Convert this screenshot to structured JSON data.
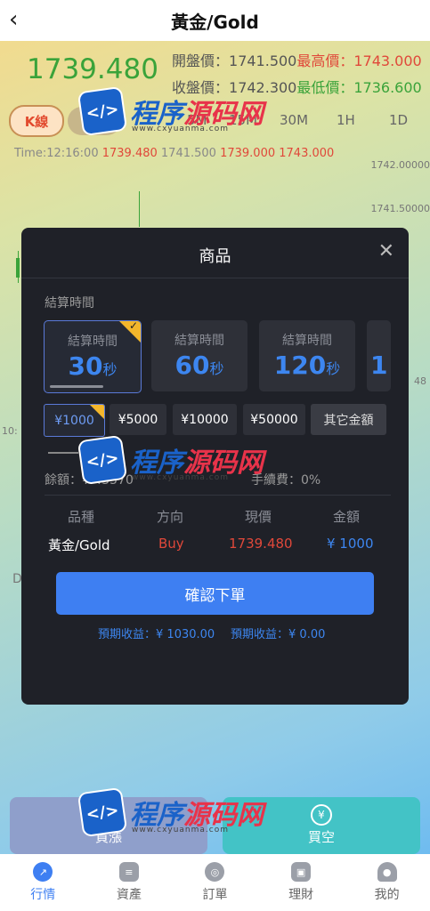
{
  "header": {
    "back_icon": "chevron-left-icon",
    "title": "黃金/Gold"
  },
  "quote": {
    "price": "1739.480",
    "open_label": "開盤價：",
    "open": "1741.500",
    "high_label": "最高價：",
    "high": "1743.000",
    "close_label": "收盤價：",
    "close": "1742.300",
    "low_label": "最低價：",
    "low": "1736.600"
  },
  "chart_tabs": {
    "kline": "K線",
    "other": "淡",
    "periods": [
      "5M",
      "15M",
      "30M",
      "1H",
      "1D"
    ]
  },
  "chart_info": {
    "time_label": "Time:",
    "time": "12:16:00",
    "v1": "1739.480",
    "v2": "1741.500",
    "v3": "1739.000",
    "v4": "1743.000",
    "y_ticks": [
      "1742.00000",
      "1741.50000",
      "48"
    ],
    "left_tick": "10:",
    "left_marker": "D"
  },
  "modal": {
    "title": "商品",
    "close_icon": "close-icon",
    "settle_label": "結算時間",
    "time_options": [
      {
        "label": "結算時間",
        "value": "30",
        "unit": "秒",
        "selected": true
      },
      {
        "label": "結算時間",
        "value": "60",
        "unit": "秒",
        "selected": false
      },
      {
        "label": "結算時間",
        "value": "120",
        "unit": "秒",
        "selected": false
      },
      {
        "label": "",
        "value": "1",
        "unit": "",
        "selected": false
      }
    ],
    "amount_options": [
      "¥1000",
      "¥5000",
      "¥10000",
      "¥50000"
    ],
    "other_amount": "其它金額",
    "balance_label": "餘額：",
    "balance_value": "¥ 45570",
    "fee_label": "手續費：",
    "fee_value": "0%",
    "columns": [
      "品種",
      "方向",
      "現價",
      "金額"
    ],
    "row": {
      "symbol": "黃金/Gold",
      "direction": "Buy",
      "price": "1739.480",
      "amount": "¥ 1000"
    },
    "confirm_label": "確認下單",
    "expect1_label": "預期收益：",
    "expect1_value": "¥ 1030.00",
    "expect2_label": "預期收益：",
    "expect2_value": "¥  0.00"
  },
  "actions": {
    "up_label": "買漲",
    "down_label": "買空",
    "up_icon": "yen-icon",
    "down_icon": "yen-icon"
  },
  "navbar": [
    {
      "label": "行情",
      "icon": "compass-icon",
      "active": true
    },
    {
      "label": "資產",
      "icon": "wallet-icon",
      "active": false
    },
    {
      "label": "訂單",
      "icon": "order-icon",
      "active": false
    },
    {
      "label": "理財",
      "icon": "finance-icon",
      "active": false
    },
    {
      "label": "我的",
      "icon": "user-icon",
      "active": false
    }
  ],
  "watermark": {
    "logo_text": "</>",
    "main1": "程序",
    "main2": "源码网",
    "sub": "www.cxyuanma.com"
  },
  "colors": {
    "accent": "#3e7ff2",
    "up": "#e0483a",
    "down": "#3aa33a",
    "modal_bg": "#1f2128",
    "badge": "#f3b62b"
  }
}
